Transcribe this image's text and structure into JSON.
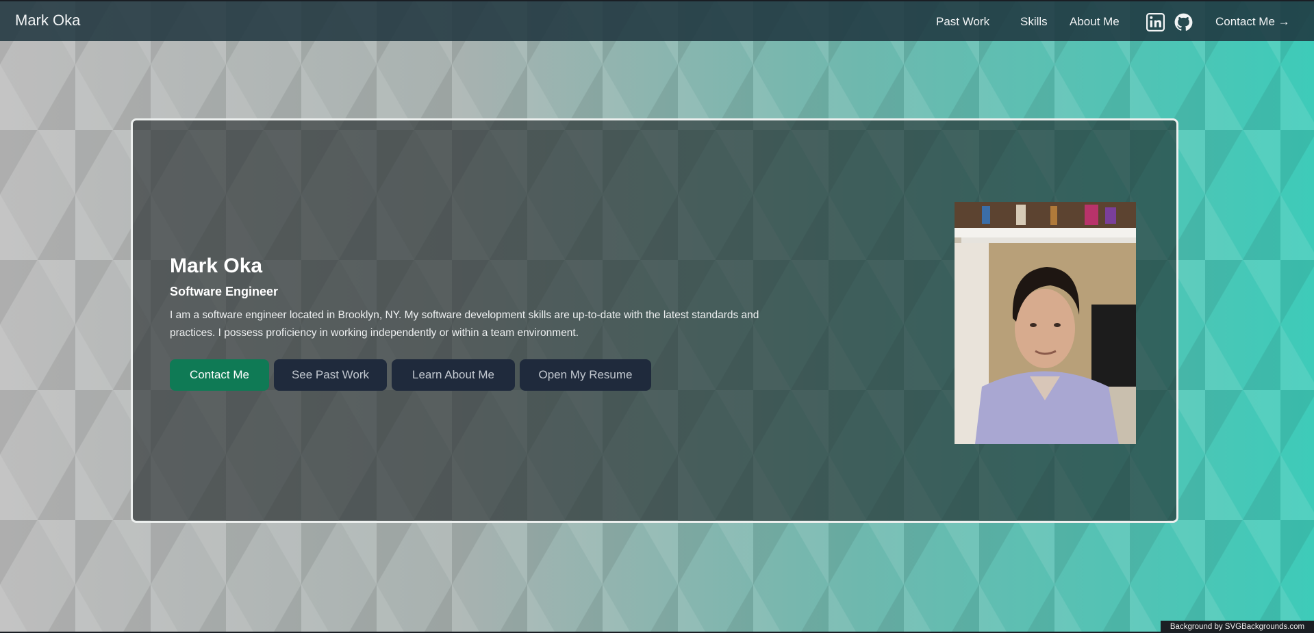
{
  "nav": {
    "brand": "Mark Oka",
    "links": [
      "Past Work",
      "Skills",
      "About Me"
    ],
    "contact_label": "Contact Me",
    "contact_icon": "arrow-right-icon",
    "social_icons": [
      "linkedin-icon",
      "github-icon"
    ]
  },
  "hero": {
    "name": "Mark Oka",
    "role": "Software Engineer",
    "description": "I am a software engineer located in Brooklyn, NY. My software development skills are up-to-date with the latest standards and practices. I possess proficiency in working independently or within a team environment.",
    "buttons": [
      "Contact Me",
      "See Past Work",
      "Learn About Me",
      "Open My Resume"
    ],
    "photo": "profile-photo"
  },
  "footer": {
    "credit": "Background by SVGBackgrounds.com"
  },
  "colors": {
    "primary_button": "#0f7a55",
    "dark_button": "#1f2a3c",
    "navbar": "#1e343e",
    "accent_teal": "#3ecbb9"
  }
}
